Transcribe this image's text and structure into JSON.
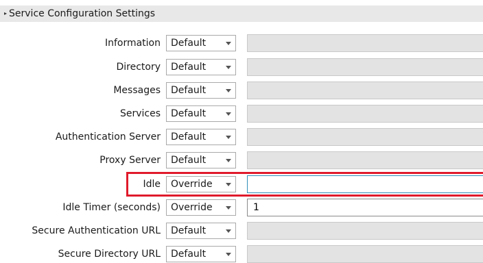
{
  "section": {
    "title": "Service Configuration Settings"
  },
  "rows": [
    {
      "label": "Information",
      "mode": "Default",
      "value": ""
    },
    {
      "label": "Directory",
      "mode": "Default",
      "value": ""
    },
    {
      "label": "Messages",
      "mode": "Default",
      "value": ""
    },
    {
      "label": "Services",
      "mode": "Default",
      "value": ""
    },
    {
      "label": "Authentication Server",
      "mode": "Default",
      "value": ""
    },
    {
      "label": "Proxy Server",
      "mode": "Default",
      "value": ""
    },
    {
      "label": "Idle",
      "mode": "Override",
      "value": ""
    },
    {
      "label": "Idle Timer (seconds)",
      "mode": "Override",
      "value": "1"
    },
    {
      "label": "Secure Authentication URL",
      "mode": "Default",
      "value": ""
    },
    {
      "label": "Secure Directory URL",
      "mode": "Default",
      "value": ""
    }
  ],
  "colors": {
    "highlight": "#e01a2b",
    "disabled_field": "#e3e3e3",
    "focus_border": "#2e8db8"
  }
}
